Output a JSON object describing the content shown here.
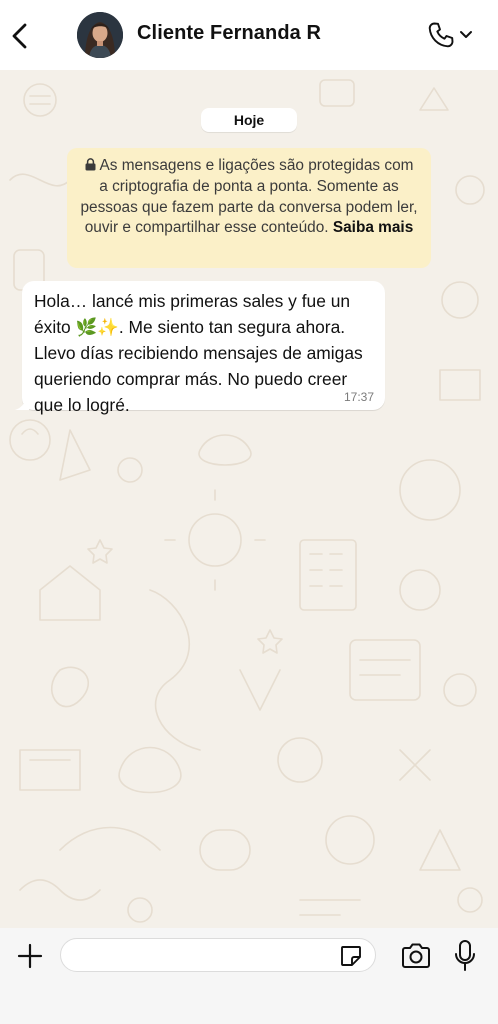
{
  "header": {
    "contact_name": "Cliente Fernanda R",
    "back_icon": "chevron-left-icon",
    "call_icon": "phone-icon",
    "call_menu_icon": "chevron-down-icon"
  },
  "chat": {
    "date_label": "Hoje",
    "encryption_notice": {
      "text": "As mensagens e ligações são protegidas com a criptografia de ponta a ponta. Somente as pessoas que fazem parte da conversa podem ler, ouvir e compartilhar esse conteúdo.",
      "link": "Saiba mais",
      "icon": "lock-icon"
    },
    "messages": [
      {
        "direction": "incoming",
        "text_part1": "Hola… lancé mis primeras sales y fue un éxito ",
        "emoji": "🌿✨",
        "text_part2": ". Me siento tan segura ahora. Llevo días recibiendo mensajes de amigas queriendo comprar más. No puedo creer que lo logré.",
        "time": "17:37"
      }
    ]
  },
  "composer": {
    "input_value": "",
    "plus_icon": "plus-icon",
    "sticker_icon": "sticker-icon",
    "camera_icon": "camera-icon",
    "mic_icon": "microphone-icon"
  },
  "colors": {
    "chat_background": "#f4f0e9",
    "notice_background": "#fbf0c8",
    "bubble_background": "#ffffff",
    "header_background": "#ffffff",
    "composer_background": "#f6f6f6"
  }
}
